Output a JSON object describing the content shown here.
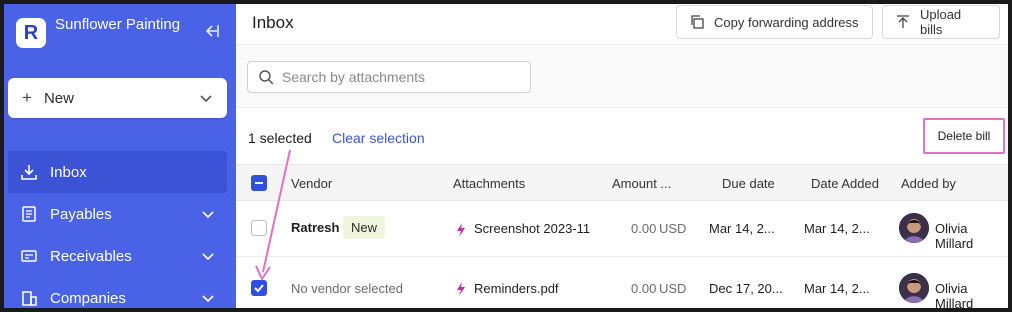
{
  "sidebar": {
    "logo_letter": "R",
    "company_name": "Sunflower Painting",
    "new_label": "New",
    "items": [
      {
        "label": "Inbox",
        "active": true,
        "icon": "download-tray-icon"
      },
      {
        "label": "Payables",
        "active": false,
        "icon": "document-icon"
      },
      {
        "label": "Receivables",
        "active": false,
        "icon": "invoice-icon"
      },
      {
        "label": "Companies",
        "active": false,
        "icon": "building-icon"
      }
    ]
  },
  "header": {
    "title": "Inbox",
    "copy_forwarding": "Copy forwarding address",
    "upload_bills": "Upload bills"
  },
  "search": {
    "placeholder": "Search by attachments"
  },
  "selection": {
    "count_text": "1 selected",
    "clear_label": "Clear selection",
    "delete_label": "Delete bill"
  },
  "table": {
    "columns": [
      "Vendor",
      "Attachments",
      "Amount ...",
      "Due date",
      "Date Added",
      "Added by"
    ],
    "rows": [
      {
        "checked": false,
        "vendor": "Ratresh",
        "badge": "New",
        "attachment": "Screenshot 2023-11",
        "amount": "0.00",
        "currency": "USD",
        "due_date": "Mar 14, 2...",
        "date_added": "Mar 14, 2...",
        "added_by": "Olivia Millard"
      },
      {
        "checked": true,
        "vendor": "No vendor selected",
        "badge": "",
        "attachment": "Reminders.pdf",
        "amount": "0.00",
        "currency": "USD",
        "due_date": "Dec 17, 20...",
        "date_added": "Mar 14, 2...",
        "added_by": "Olivia Millard"
      }
    ]
  },
  "colors": {
    "sidebar": "#4a63e6",
    "accent": "#2f4fe0",
    "highlight": "#e56fc0",
    "attachment_icon": "#c12ea3"
  }
}
